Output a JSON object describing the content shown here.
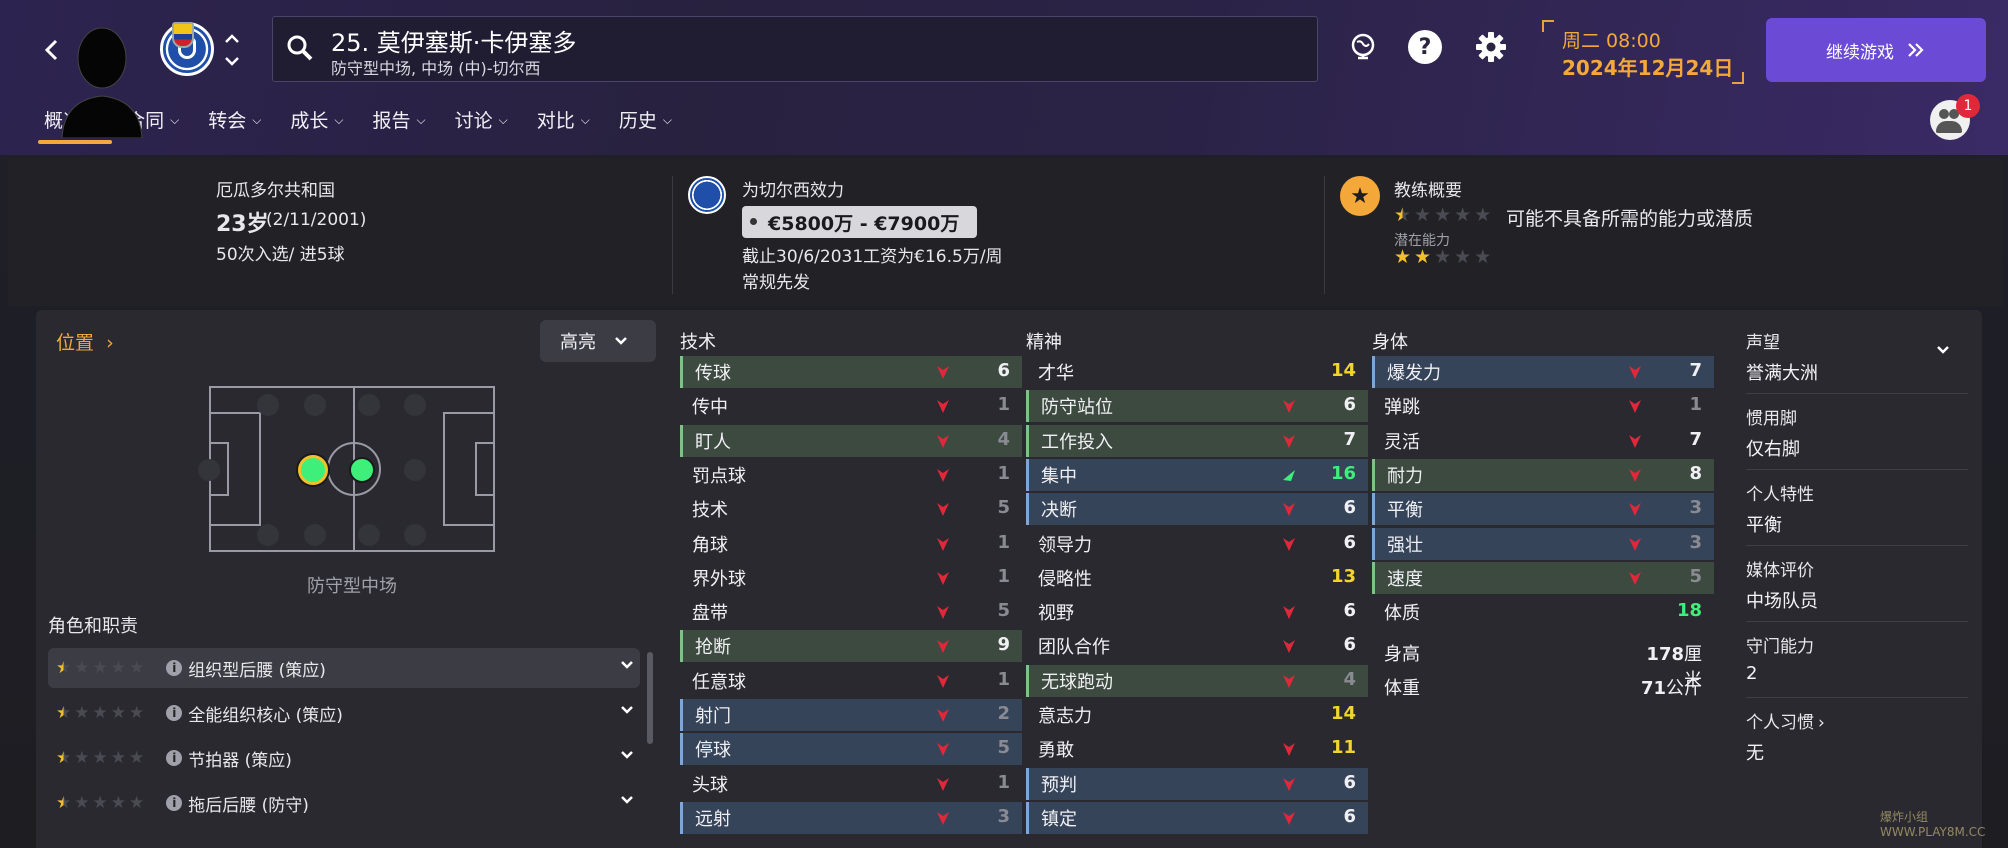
{
  "header": {
    "player_number_name": "25. 莫伊塞斯·卡伊塞多",
    "player_subtitle": "防守型中场, 中场 (中)-切尔西",
    "date_line1": "周二 08:00",
    "date_line2": "2024年12月24日",
    "continue_label": "继续游戏",
    "notification_count": "1"
  },
  "tabs": [
    "概况",
    "合同",
    "转会",
    "成长",
    "报告",
    "讨论",
    "对比",
    "历史"
  ],
  "overview": {
    "nationality": "厄瓜多尔共和国",
    "age": "23岁",
    "birthdate": "(2/11/2001)",
    "caps": "50次入选/ 进5球",
    "club_line": "为切尔西效力",
    "value": "€5800万 - €7900万",
    "contract": "截止30/6/2031工资为€16.5万/周",
    "squad_status": "常规先发",
    "coach_title": "教练概要",
    "coach_note": "可能不具备所需的能力或潜质",
    "potential_label": "潜在能力",
    "current_stars": 0.5,
    "potential_stars": 2
  },
  "position": {
    "link_label": "位置",
    "highlight_label": "高亮",
    "position_name": "防守型中场",
    "roles_title": "角色和职责",
    "roles": [
      {
        "name": "组织型后腰 (策应)",
        "stars": 0.5
      },
      {
        "name": "全能组织核心 (策应)",
        "stars": 0.5
      },
      {
        "name": "节拍器 (策应)",
        "stars": 0.5
      },
      {
        "name": "拖后后腰 (防守)",
        "stars": 0.5
      }
    ]
  },
  "attributes": {
    "technical_title": "技术",
    "mental_title": "精神",
    "physical_title": "身体",
    "technical": [
      {
        "name": "传球",
        "value": "6",
        "style": "hl-green",
        "color": "w",
        "trend": "down"
      },
      {
        "name": "传中",
        "value": "1",
        "style": "none",
        "color": "g",
        "trend": "down"
      },
      {
        "name": "盯人",
        "value": "4",
        "style": "hl-green",
        "color": "g",
        "trend": "down"
      },
      {
        "name": "罚点球",
        "value": "1",
        "style": "none",
        "color": "g",
        "trend": "down"
      },
      {
        "name": "技术",
        "value": "5",
        "style": "none",
        "color": "g",
        "trend": "down"
      },
      {
        "name": "角球",
        "value": "1",
        "style": "none",
        "color": "g",
        "trend": "down"
      },
      {
        "name": "界外球",
        "value": "1",
        "style": "none",
        "color": "g",
        "trend": "down"
      },
      {
        "name": "盘带",
        "value": "5",
        "style": "none",
        "color": "g",
        "trend": "down"
      },
      {
        "name": "抢断",
        "value": "9",
        "style": "hl-green",
        "color": "w",
        "trend": "down"
      },
      {
        "name": "任意球",
        "value": "1",
        "style": "none",
        "color": "g",
        "trend": "down"
      },
      {
        "name": "射门",
        "value": "2",
        "style": "hl-blue",
        "color": "g",
        "trend": "down"
      },
      {
        "name": "停球",
        "value": "5",
        "style": "hl-blue",
        "color": "g",
        "trend": "down"
      },
      {
        "name": "头球",
        "value": "1",
        "style": "none",
        "color": "g",
        "trend": "down"
      },
      {
        "name": "远射",
        "value": "3",
        "style": "hl-blue",
        "color": "g",
        "trend": "down"
      }
    ],
    "mental": [
      {
        "name": "才华",
        "value": "14",
        "style": "none",
        "color": "y",
        "trend": "none"
      },
      {
        "name": "防守站位",
        "value": "6",
        "style": "hl-green",
        "color": "w",
        "trend": "down"
      },
      {
        "name": "工作投入",
        "value": "7",
        "style": "hl-green",
        "color": "w",
        "trend": "down"
      },
      {
        "name": "集中",
        "value": "16",
        "style": "hl-blue",
        "color": "gr",
        "trend": "up"
      },
      {
        "name": "决断",
        "value": "6",
        "style": "hl-blue",
        "color": "w",
        "trend": "down"
      },
      {
        "name": "领导力",
        "value": "6",
        "style": "none",
        "color": "w",
        "trend": "down"
      },
      {
        "name": "侵略性",
        "value": "13",
        "style": "none",
        "color": "y",
        "trend": "none"
      },
      {
        "name": "视野",
        "value": "6",
        "style": "none",
        "color": "w",
        "trend": "down"
      },
      {
        "name": "团队合作",
        "value": "6",
        "style": "none",
        "color": "w",
        "trend": "down"
      },
      {
        "name": "无球跑动",
        "value": "4",
        "style": "hl-green",
        "color": "g",
        "trend": "down"
      },
      {
        "name": "意志力",
        "value": "14",
        "style": "none",
        "color": "y",
        "trend": "none"
      },
      {
        "name": "勇敢",
        "value": "11",
        "style": "none",
        "color": "y",
        "trend": "down"
      },
      {
        "name": "预判",
        "value": "6",
        "style": "hl-blue",
        "color": "w",
        "trend": "down"
      },
      {
        "name": "镇定",
        "value": "6",
        "style": "hl-blue",
        "color": "w",
        "trend": "down"
      }
    ],
    "physical": [
      {
        "name": "爆发力",
        "value": "7",
        "style": "hl-blue",
        "color": "w",
        "trend": "down"
      },
      {
        "name": "弹跳",
        "value": "1",
        "style": "none",
        "color": "g",
        "trend": "down"
      },
      {
        "name": "灵活",
        "value": "7",
        "style": "none",
        "color": "w",
        "trend": "down"
      },
      {
        "name": "耐力",
        "value": "8",
        "style": "hl-green",
        "color": "w",
        "trend": "down"
      },
      {
        "name": "平衡",
        "value": "3",
        "style": "hl-blue",
        "color": "g",
        "trend": "down"
      },
      {
        "name": "强壮",
        "value": "3",
        "style": "hl-blue",
        "color": "g",
        "trend": "down"
      },
      {
        "name": "速度",
        "value": "5",
        "style": "hl-green",
        "color": "g",
        "trend": "down"
      },
      {
        "name": "体质",
        "value": "18",
        "style": "none",
        "color": "gr",
        "trend": "none"
      }
    ],
    "height_label": "身高",
    "height_value": "178",
    "height_unit": "厘米",
    "weight_label": "体重",
    "weight_value": "71",
    "weight_unit": "公斤"
  },
  "side_info": [
    {
      "label": "声望",
      "value": "誉满大洲"
    },
    {
      "label": "惯用脚",
      "value": "仅右脚"
    },
    {
      "label": "个人特性",
      "value": "平衡"
    },
    {
      "label": "媒体评价",
      "value": "中场队员"
    },
    {
      "label": "守门能力",
      "value": "2"
    },
    {
      "label": "个人习惯",
      "value": "无"
    }
  ],
  "watermark": "爆炸小组 WWW.PLAY8M.CC",
  "colors": {
    "accent_orange": "#f4a83a",
    "button_purple": "#6b4ad6",
    "value_yellow": "#f2d431",
    "value_green": "#3ef07a",
    "trend_down_red": "#e0283a"
  }
}
